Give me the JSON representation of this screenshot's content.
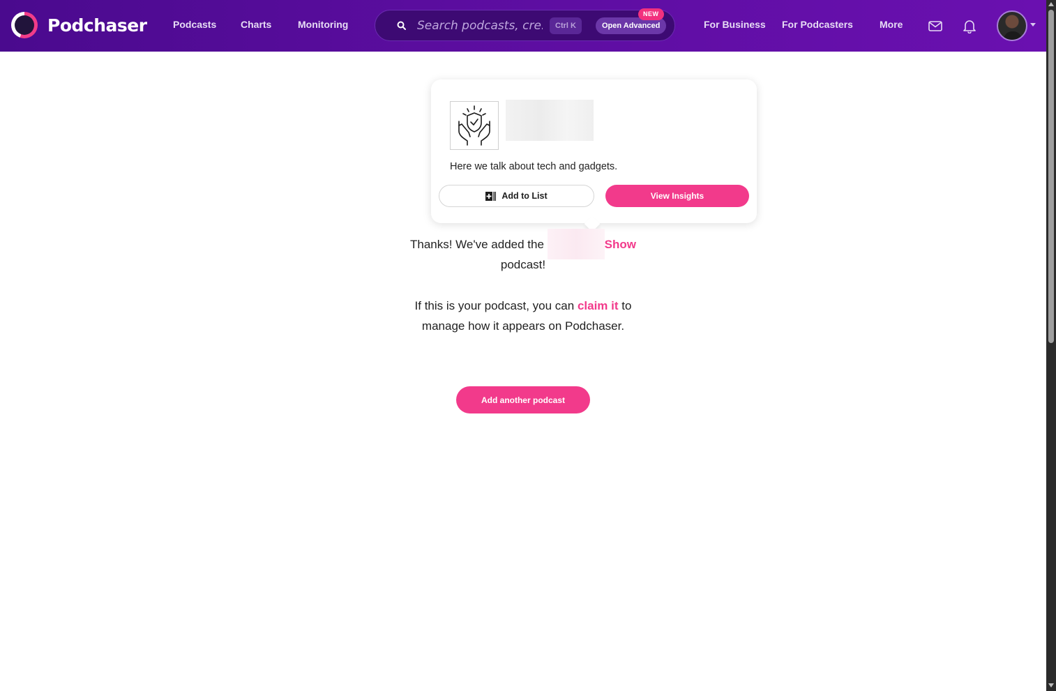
{
  "header": {
    "brand": "Podchaser",
    "nav": [
      "Podcasts",
      "Charts",
      "Monitoring"
    ],
    "search": {
      "placeholder": "Search podcasts, cre...",
      "shortcut": "Ctrl K",
      "advanced_label": "Open Advanced",
      "new_badge": "NEW"
    },
    "right_nav": [
      "For Business",
      "For Podcasters",
      "More"
    ],
    "icons": [
      "mail-icon",
      "bell-icon"
    ]
  },
  "card": {
    "description": "Here we talk about tech and gadgets.",
    "add_to_list_label": "Add to List",
    "view_insights_label": "View Insights"
  },
  "message": {
    "thanks_prefix": "Thanks! We've added the",
    "show_name_visible": "Show",
    "thanks_suffix": "podcast!",
    "claim_prefix": "If this is your podcast, you can",
    "claim_link": "claim it",
    "claim_suffix_1": "to",
    "claim_suffix_2": "manage how it appears on Podchaser."
  },
  "add_another_label": "Add another podcast",
  "colors": {
    "header_gradient_start": "#4a0a8e",
    "header_gradient_end": "#6a10b0",
    "accent_pink": "#f23a8b"
  }
}
